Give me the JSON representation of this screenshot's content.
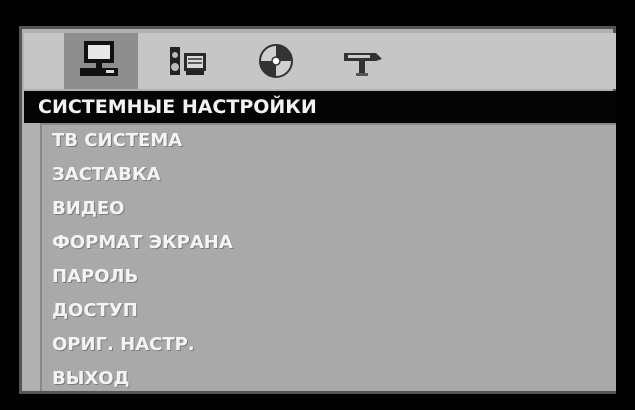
{
  "header": {
    "title": "СИСТЕМНЫЕ НАСТРОЙКИ"
  },
  "tabs": [
    {
      "icon": "computer-icon",
      "active": true
    },
    {
      "icon": "speaker-icon",
      "active": false
    },
    {
      "icon": "disc-icon",
      "active": false
    },
    {
      "icon": "tools-icon",
      "active": false
    }
  ],
  "menu": {
    "items": [
      {
        "label": "ТВ СИСТЕМА"
      },
      {
        "label": "ЗАСТАВКА"
      },
      {
        "label": "ВИДЕО"
      },
      {
        "label": "ФОРМАТ ЭКРАНА"
      },
      {
        "label": "ПАРОЛЬ"
      },
      {
        "label": "ДОСТУП"
      },
      {
        "label": "ОРИГ. НАСТР."
      },
      {
        "label": "ВЫХОД"
      }
    ]
  },
  "colors": {
    "frame": "#b1b1b1",
    "header_bg": "#050505",
    "menu_bg": "#a9a9a9",
    "active_tab": "#8e8e8e",
    "text": "#f4f4f4"
  }
}
